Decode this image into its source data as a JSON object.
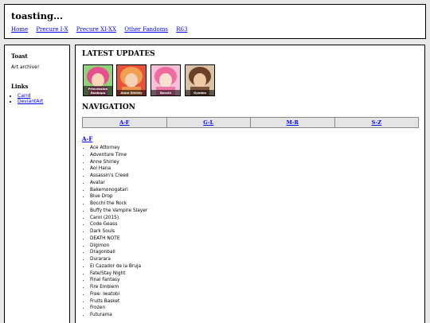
{
  "site": {
    "title": "toasting...",
    "nav": [
      "Home",
      "Precure I-X",
      "Precure XI-XX",
      "Other Fandoms",
      "R63"
    ]
  },
  "sidebar": {
    "heading": "Toast",
    "text": "Art archive!",
    "links_heading": "Links",
    "links": [
      "Carrd",
      "DeviantArt"
    ]
  },
  "main": {
    "latest_heading": "LATEST UPDATES",
    "latest": [
      {
        "caption": "Princession Dosbupu",
        "bg": "#8fd37b",
        "fg": "#e84f8f",
        "face": "#f8d6b8"
      },
      {
        "caption": "Anne Shirley",
        "bg": "#e8523a",
        "fg": "#f0a050",
        "face": "#f4d0b4"
      },
      {
        "caption": "Bocchi",
        "bg": "#f4c1d8",
        "fg": "#f06ca0",
        "face": "#fbe1cf"
      },
      {
        "caption": "Gyodos",
        "bg": "#d9c3a5",
        "fg": "#6b3f2a",
        "face": "#efc9a3"
      }
    ],
    "navigation_heading": "NAVIGATION",
    "nav_cells": [
      "A-F",
      "G-L",
      "M-R",
      "S-Z"
    ],
    "af_heading": "A-F",
    "fandoms": [
      "Ace Attorney",
      "Adventure Time",
      "Anne Shirley",
      "Aoi Hana",
      "Assassin's Creed",
      "Avatar",
      "Bakemonogatari",
      "Blue Drop",
      "Bocchi the Rock",
      "Buffy the Vampire Slayer",
      "Carol (2015)",
      "Code Geass",
      "Dark Souls",
      "DEATH NOTE",
      "Digimon",
      "Dragonball",
      "Durarara",
      "El Cazador de la Bruja",
      "Fate/Stay Night",
      "Final Fantasy",
      "Fire Emblem",
      "Free: Iwatobi",
      "Fruits Basket",
      "Frozen",
      "Futurama"
    ]
  }
}
